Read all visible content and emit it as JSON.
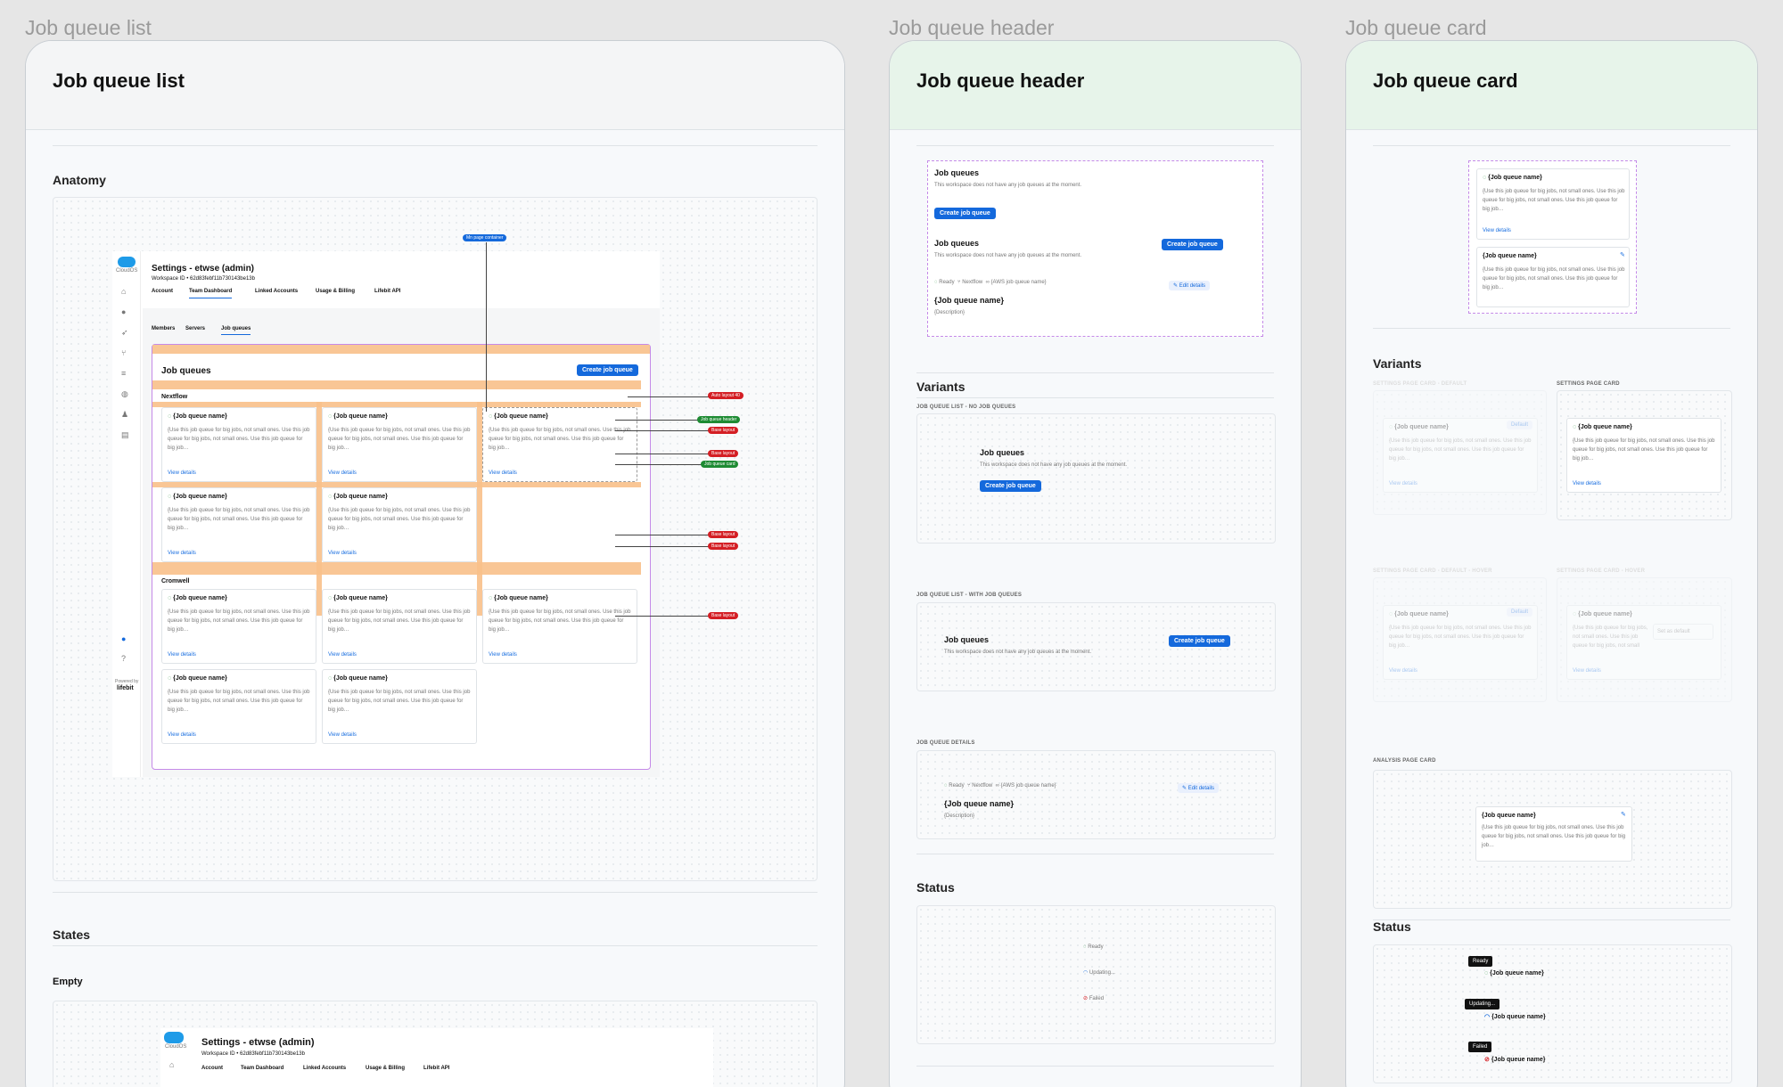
{
  "frames": {
    "list": {
      "label": "Job queue list",
      "title": "Job queue list",
      "sections": {
        "anatomy": "Anatomy",
        "states": "States",
        "empty": "Empty"
      }
    },
    "header": {
      "label": "Job queue header",
      "title": "Job queue header",
      "sections": {
        "variants": "Variants",
        "status": "Status"
      }
    },
    "card": {
      "label": "Job queue card",
      "title": "Job queue card",
      "sections": {
        "variants": "Variants",
        "status": "Status"
      }
    }
  },
  "app": {
    "logo": "CloudOS",
    "settings_title": "Settings - etwse (admin)",
    "workspace_id": "Workspace ID • 62d83febf11b730143be13b",
    "tabs": [
      "Account",
      "Team Dashboard",
      "Linked Accounts",
      "Usage & Billing",
      "Lifebit API"
    ],
    "subtabs": [
      "Members",
      "Servers",
      "Job queues"
    ],
    "powered_by": "Powered by",
    "brand": "lifebit"
  },
  "anatomy": {
    "page_heading": "Job queues",
    "create_button": "Create job queue",
    "groups": [
      "Nextflow",
      "Cromwell"
    ],
    "tags": {
      "container": "Mn page container",
      "auto_layout": "Auto layout 40",
      "header": "Job queue header",
      "base_layout": "Base layout",
      "card": "Job queue card"
    }
  },
  "card_content": {
    "name": "{Job queue name}",
    "description": "{Use this job queue for big jobs, not small ones. Use this job queue for big jobs, not small ones. Use this job queue for big job…",
    "view_details": "View details"
  },
  "header_content": {
    "title": "Job queues",
    "empty_text": "This workspace does not have any job queues at the moment.",
    "create_button": "Create job queue",
    "ready": "Ready",
    "nextflow": "Nextflow",
    "aws": "{AWS job queue name}",
    "edit": "Edit details",
    "queue_name": "{Job queue name}",
    "description": "{Description}"
  },
  "header_variants": {
    "no_queues": "JOB QUEUE LIST - NO JOB QUEUES",
    "with_queues": "JOB QUEUE LIST - WITH JOB QUEUES",
    "details": "JOB QUEUE DETAILS"
  },
  "status": {
    "ready": "Ready",
    "updating": "Updating...",
    "failed": "Failed"
  },
  "card_variants": {
    "settings_default": "SETTINGS PAGE CARD - DEFAULT",
    "settings": "SETTINGS PAGE CARD",
    "settings_default_hover": "SETTINGS PAGE CARD - DEFAULT - HOVER",
    "settings_hover": "SETTINGS PAGE CARD - HOVER",
    "analysis": "ANALYSIS PAGE CARD",
    "default_badge": "Default",
    "set_default": "Set as default"
  },
  "colors": {
    "accent": "#1469dc",
    "green_header": "#e7f4ea",
    "ready": "#1e8b33",
    "failed": "#d41e24",
    "highlight": "#f8c08a"
  }
}
